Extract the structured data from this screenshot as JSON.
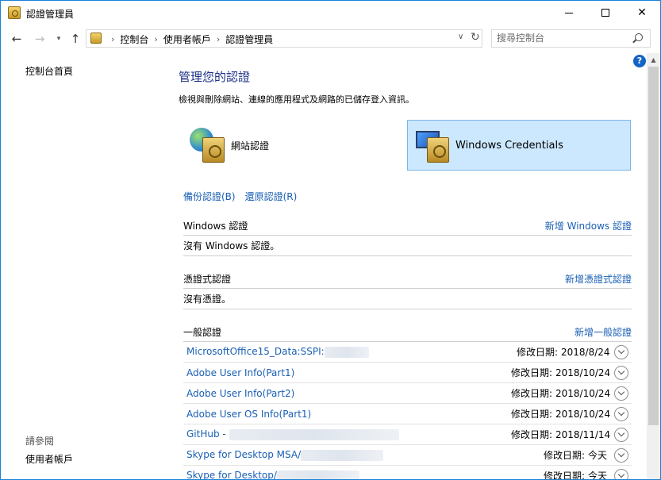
{
  "window": {
    "title": "認證管理員"
  },
  "nav": {
    "breadcrumbs": [
      "控制台",
      "使用者帳戶",
      "認證管理員"
    ],
    "search_placeholder": "搜尋控制台"
  },
  "sidebar": {
    "home": "控制台首頁",
    "see_also": "請參閱",
    "user_accounts": "使用者帳戶"
  },
  "main": {
    "title": "管理您的認證",
    "description": "檢視與刪除網站、連線的應用程式及網路的已儲存登入資訊。",
    "categories": {
      "web": "網站認證",
      "windows": "Windows Credentials"
    },
    "backup": "備份認證(B)",
    "restore": "還原認證(R)",
    "sections": {
      "windows": {
        "title": "Windows 認證",
        "add": "新增 Windows 認證",
        "empty": "沒有 Windows 認證。"
      },
      "cert": {
        "title": "憑證式認證",
        "add": "新增憑證式認證",
        "empty": "沒有憑證。"
      },
      "generic": {
        "title": "一般認證",
        "add": "新增一般認證",
        "rows": [
          {
            "name": "MicrosoftOffice15_Data:SSPI:",
            "date_label": "修改日期:",
            "date": "2018/8/24"
          },
          {
            "name": "Adobe User Info(Part1)",
            "date_label": "修改日期:",
            "date": "2018/10/24"
          },
          {
            "name": "Adobe User Info(Part2)",
            "date_label": "修改日期:",
            "date": "2018/10/24"
          },
          {
            "name": "Adobe User OS Info(Part1)",
            "date_label": "修改日期:",
            "date": "2018/10/24"
          },
          {
            "name": "GitHub - ",
            "date_label": "修改日期:",
            "date": "2018/11/14"
          },
          {
            "name": "Skype for Desktop MSA/",
            "date_label": "修改日期:",
            "date": "今天"
          },
          {
            "name": "Skype for Desktop/",
            "date_label": "修改日期:",
            "date": "今天"
          }
        ]
      }
    }
  }
}
